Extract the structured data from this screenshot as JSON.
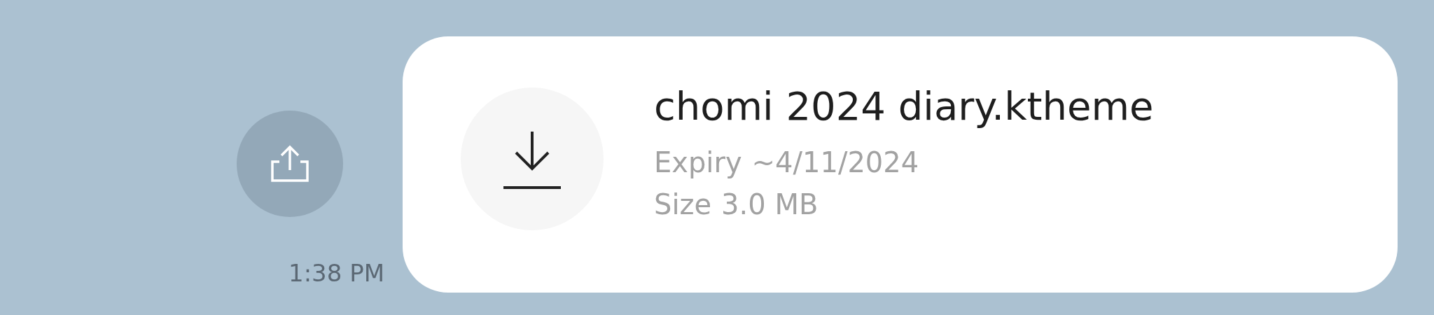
{
  "message": {
    "time": "1:38 PM",
    "file": {
      "name": "chomi 2024 diary.ktheme",
      "expiry_label": "Expiry",
      "expiry_value": "~4/11/2024",
      "size_label": "Size",
      "size_value": "3.0 MB"
    }
  }
}
